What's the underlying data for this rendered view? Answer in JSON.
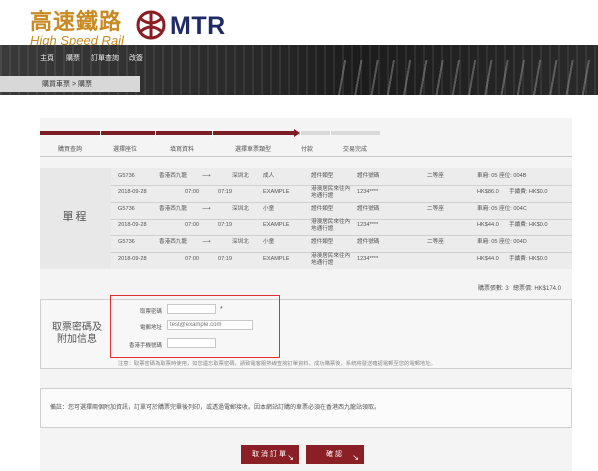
{
  "header": {
    "logo_cn": "高速鐵路",
    "logo_en": "High Speed Rail",
    "brand": "MTR"
  },
  "colors": {
    "brand_gold": "#c98a22",
    "brand_navy": "#1e2b64",
    "accent_red": "#7a1e24",
    "highlight_red": "#e03030"
  },
  "nav": {
    "items": [
      "主頁",
      "購票",
      "訂單查詢",
      "改簽"
    ]
  },
  "breadcrumb": "購買車票 > 購票",
  "steps": [
    "購買查詢",
    "選擇座位",
    "填寫資料",
    "選擇車票類型",
    "付款",
    "交易完成"
  ],
  "itinerary": {
    "label": "單程",
    "rows": [
      {
        "train": "G5736",
        "date": "2018-09-28",
        "from": "香港西九龍",
        "to": "深圳北",
        "dep": "07:00",
        "arr": "07:19",
        "pax_type": "成人",
        "pax_name": "EXAMPLE",
        "doc_type": "證件類型",
        "doc_desc": "港澳居民來往內地通行證",
        "doc_no_label": "證件號碼",
        "doc_no": "1234****",
        "class": "二等座",
        "seat": "車廂: 05  座位: 004B",
        "fare": "HK$86.0",
        "fee": "手續費: HK$0.0"
      },
      {
        "train": "G5736",
        "date": "2018-09-28",
        "from": "香港西九龍",
        "to": "深圳北",
        "dep": "07:00",
        "arr": "07:19",
        "pax_type": "小童",
        "pax_name": "EXAMPLE",
        "doc_type": "證件類型",
        "doc_desc": "港澳居民來往內地通行證",
        "doc_no_label": "證件號碼",
        "doc_no": "1234****",
        "class": "二等座",
        "seat": "車廂: 05  座位: 004C",
        "fare": "HK$44.0",
        "fee": "手續費: HK$0.0"
      },
      {
        "train": "G5736",
        "date": "2018-09-28",
        "from": "香港西九龍",
        "to": "深圳北",
        "dep": "07:00",
        "arr": "07:19",
        "pax_type": "小童",
        "pax_name": "EXAMPLE",
        "doc_type": "證件類型",
        "doc_desc": "港澳居民來往內地通行證",
        "doc_no_label": "證件號碼",
        "doc_no": "1234****",
        "class": "二等座",
        "seat": "車廂: 05  座位: 004D",
        "fare": "HK$44.0",
        "fee": "手續費: HK$0.0"
      }
    ],
    "total_count_label": "購票張數: 3",
    "total_amount_label": "總票價: HK$174.0"
  },
  "collection": {
    "label": "取票密碼及附加信息",
    "fields": [
      {
        "label": "取票密碼",
        "value": "",
        "placeholder": ""
      },
      {
        "label": "電郵地址",
        "value": "",
        "placeholder": "test@example.com"
      },
      {
        "label": "香港手機號碼",
        "value": "",
        "placeholder": ""
      }
    ],
    "required_mark": "*",
    "note": "注意：取票密碼為取票時使用，如您遺忘取票密碼，請致電客服熱線查詢訂單資料。成功購票後，系統將發送確認電郵至您的電郵地址。"
  },
  "remark": "備註：您可選擇兩個附加資訊，訂單可於購票完畢後列印，或透過電郵接收。因本網站訂購的車票必須在香港西九龍站領取。",
  "buttons": {
    "cancel": "取消訂單",
    "confirm": "確認"
  }
}
